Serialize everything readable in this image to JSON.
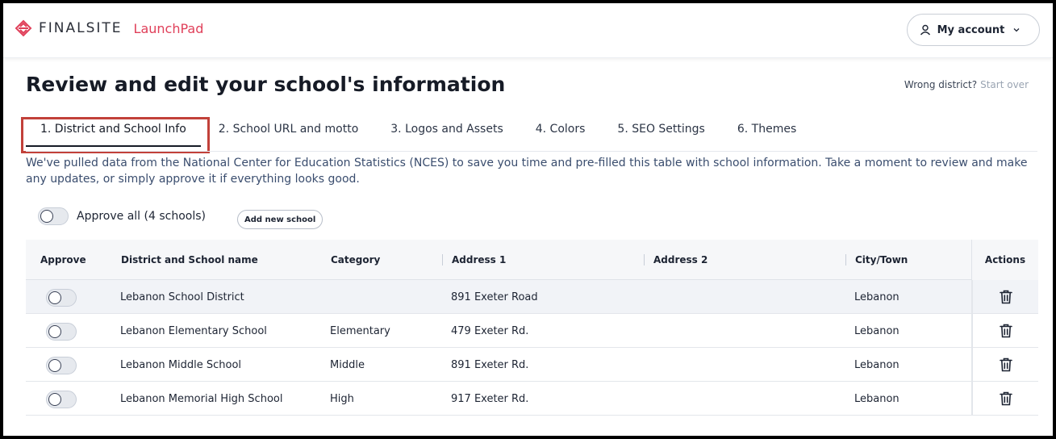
{
  "header": {
    "brand": "FINALSITE",
    "product": "LaunchPad",
    "account_label": "My account"
  },
  "page": {
    "title": "Review and edit your school's information",
    "wrong_district": "Wrong district?",
    "start_over": "Start over"
  },
  "tabs": [
    {
      "label": "1. District and School Info",
      "active": true
    },
    {
      "label": "2. School URL and motto"
    },
    {
      "label": "3. Logos and Assets"
    },
    {
      "label": "4. Colors"
    },
    {
      "label": "5. SEO Settings"
    },
    {
      "label": "6. Themes"
    }
  ],
  "intro": "We've pulled data from the National Center for Education Statistics (NCES) to save you time and pre-filled this table with school information. Take a moment to review and make any updates, or simply approve it if everything looks good.",
  "controls": {
    "approve_all": "Approve all (4 schools)",
    "add_new_school": "Add new school"
  },
  "table": {
    "headers": {
      "approve": "Approve",
      "name": "District and School name",
      "category": "Category",
      "address1": "Address 1",
      "address2": "Address 2",
      "city": "City/Town",
      "actions": "Actions"
    },
    "rows": [
      {
        "name": "Lebanon School District",
        "category": "",
        "address1": "891 Exeter Road",
        "address2": "",
        "city": "Lebanon"
      },
      {
        "name": "Lebanon Elementary School",
        "category": "Elementary",
        "address1": "479 Exeter Rd.",
        "address2": "",
        "city": "Lebanon"
      },
      {
        "name": "Lebanon Middle School",
        "category": "Middle",
        "address1": "891 Exeter Rd.",
        "address2": "",
        "city": "Lebanon"
      },
      {
        "name": "Lebanon Memorial High School",
        "category": "High",
        "address1": "917 Exeter Rd.",
        "address2": "",
        "city": "Lebanon"
      }
    ]
  },
  "colors": {
    "brand_accent": "#e0405a",
    "highlight_border": "#c2413a",
    "intro_text": "#3a4d6e"
  },
  "icons": {
    "logo": "finalsite-logo-icon",
    "account": "user-icon",
    "dropdown": "chevron-down-icon",
    "delete": "trash-icon"
  }
}
